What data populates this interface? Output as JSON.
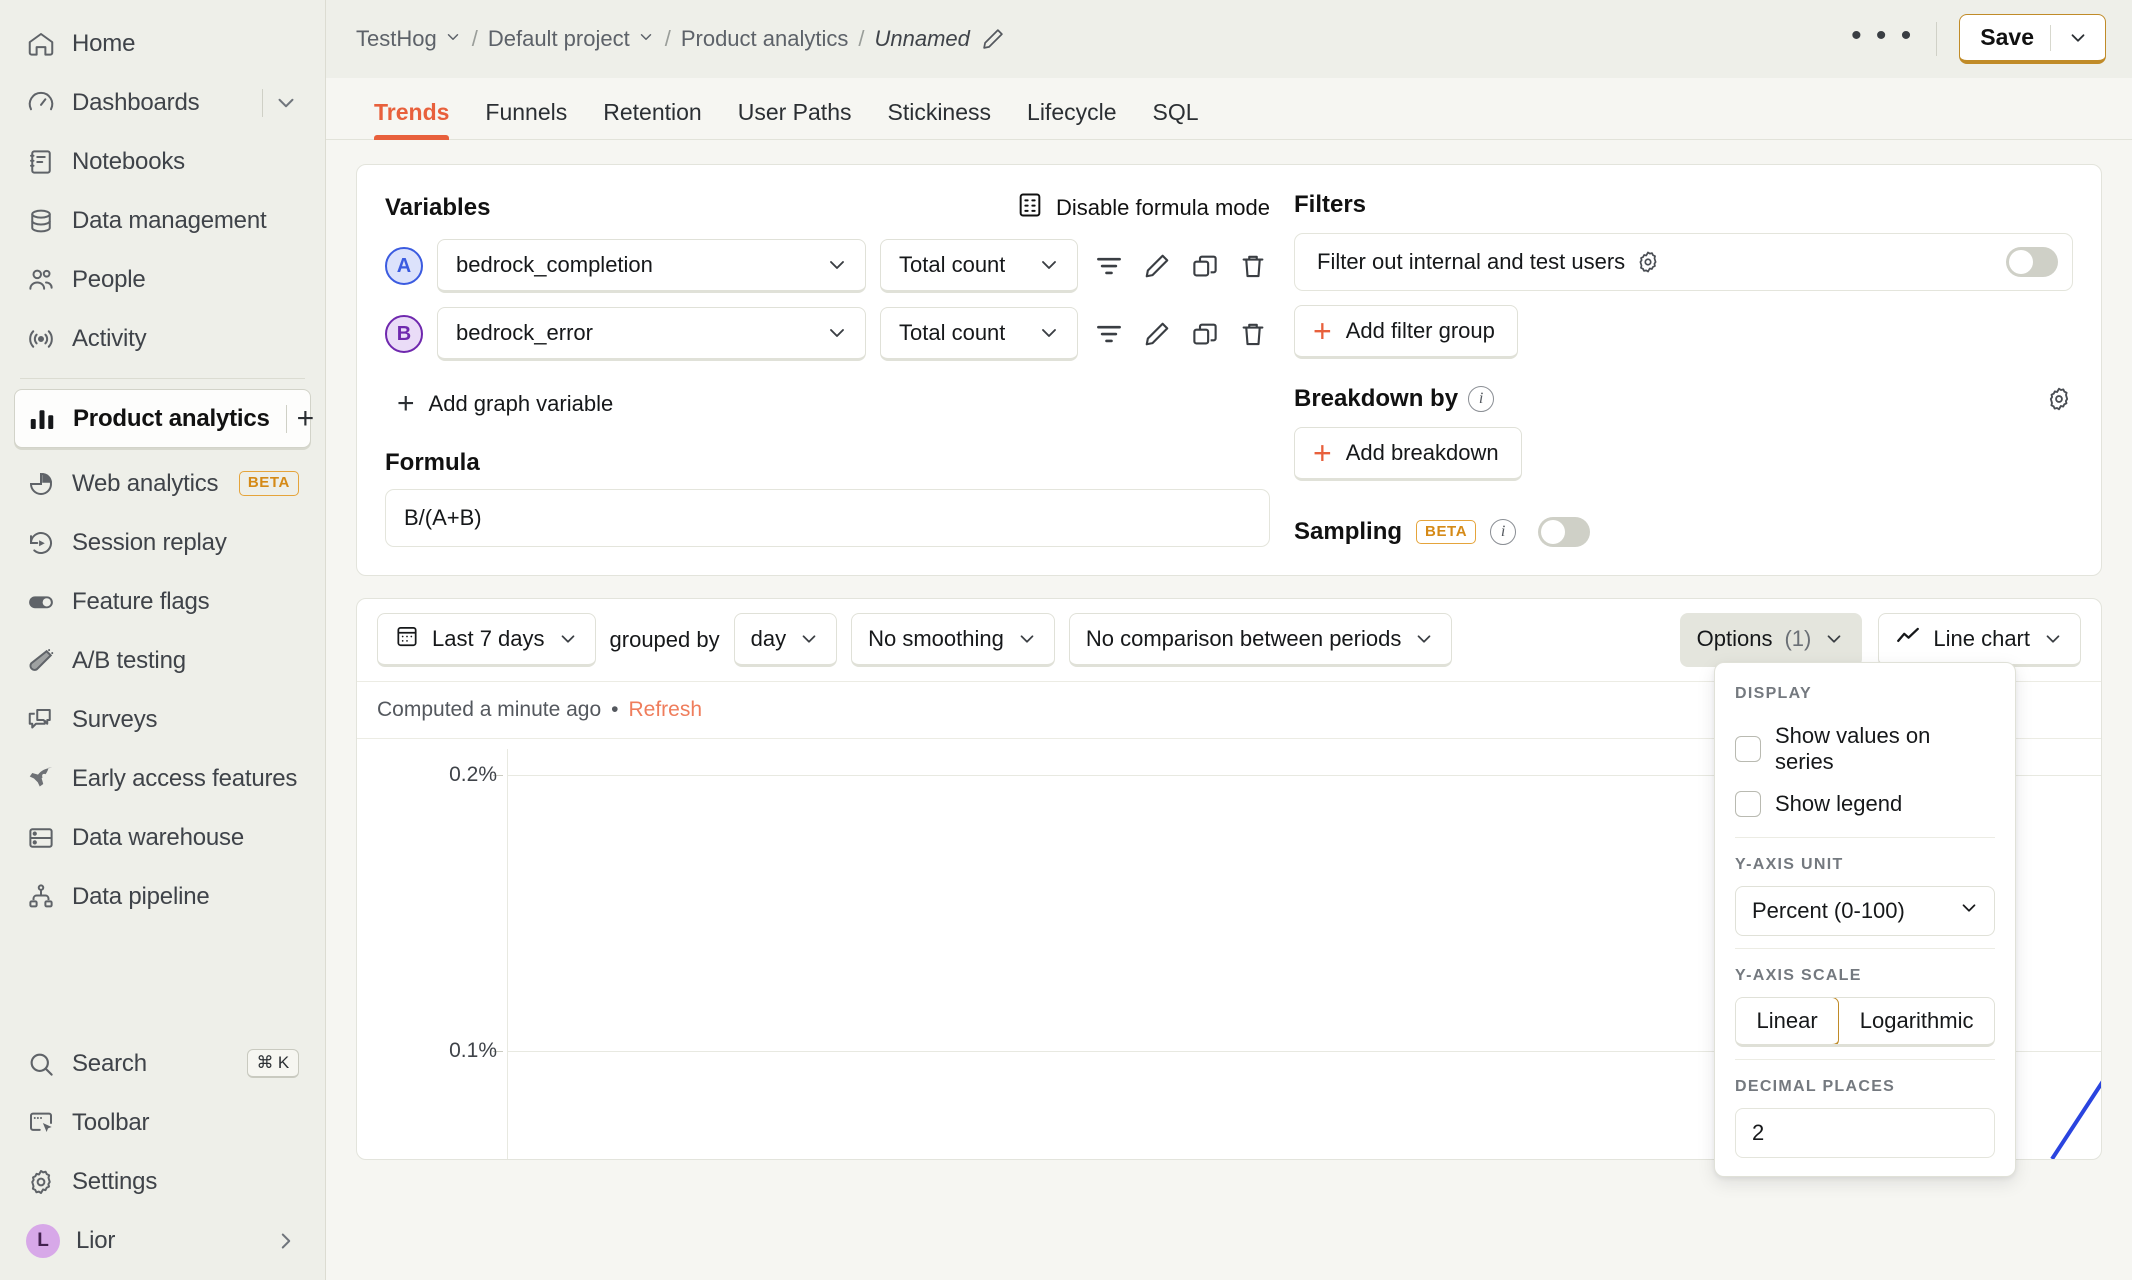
{
  "sidebar": {
    "items": [
      {
        "label": "Home",
        "icon": "home-icon"
      },
      {
        "label": "Dashboards",
        "icon": "gauge-icon",
        "has_expand": true
      },
      {
        "label": "Notebooks",
        "icon": "notebook-icon"
      },
      {
        "label": "Data management",
        "icon": "database-icon"
      },
      {
        "label": "People",
        "icon": "people-icon"
      },
      {
        "label": "Activity",
        "icon": "activity-broadcast-icon"
      }
    ],
    "active_product": {
      "label": "Product analytics",
      "icon": "bar-chart-icon",
      "add_label": "+"
    },
    "products": [
      {
        "label": "Web analytics",
        "icon": "pie-chart-icon",
        "badge": "BETA"
      },
      {
        "label": "Session replay",
        "icon": "replay-icon"
      },
      {
        "label": "Feature flags",
        "icon": "toggle-icon"
      },
      {
        "label": "A/B testing",
        "icon": "flask-icon"
      },
      {
        "label": "Surveys",
        "icon": "chat-icon"
      },
      {
        "label": "Early access features",
        "icon": "rocket-icon"
      },
      {
        "label": "Data warehouse",
        "icon": "warehouse-icon"
      },
      {
        "label": "Data pipeline",
        "icon": "pipeline-icon"
      }
    ],
    "footer": [
      {
        "label": "Search",
        "icon": "search-icon",
        "shortcut": "⌘ K"
      },
      {
        "label": "Toolbar",
        "icon": "toolbar-icon"
      },
      {
        "label": "Settings",
        "icon": "gear-icon"
      }
    ],
    "user": {
      "name": "Lior",
      "initial": "L"
    }
  },
  "topbar": {
    "breadcrumbs": [
      {
        "label": "TestHog",
        "caret": true
      },
      {
        "label": "Default project",
        "caret": true
      },
      {
        "label": "Product analytics",
        "caret": false
      },
      {
        "label": "Unnamed",
        "caret": false,
        "italic": true
      }
    ],
    "separator": "/",
    "more_label": "• • •",
    "save_label": "Save"
  },
  "tabs": [
    {
      "label": "Trends",
      "active": true
    },
    {
      "label": "Funnels",
      "active": false
    },
    {
      "label": "Retention",
      "active": false
    },
    {
      "label": "User Paths",
      "active": false
    },
    {
      "label": "Stickiness",
      "active": false
    },
    {
      "label": "Lifecycle",
      "active": false
    },
    {
      "label": "SQL",
      "active": false
    }
  ],
  "query": {
    "variables_title": "Variables",
    "formula_mode_label": "Disable formula mode",
    "series": [
      {
        "letter": "A",
        "event": "bedrock_completion",
        "math": "Total count"
      },
      {
        "letter": "B",
        "event": "bedrock_error",
        "math": "Total count"
      }
    ],
    "add_variable_label": "Add graph variable",
    "formula_title": "Formula",
    "formula_value": "B/(A+B)",
    "filters_title": "Filters",
    "filter_internal_label": "Filter out internal and test users",
    "add_filter_group_label": "Add filter group",
    "breakdown_title": "Breakdown by",
    "add_breakdown_label": "Add breakdown",
    "sampling_title": "Sampling",
    "sampling_badge": "BETA"
  },
  "insight_toolbar": {
    "date_range": "Last 7 days",
    "grouped_by_label": "grouped by",
    "interval": "day",
    "smoothing": "No smoothing",
    "comparison": "No comparison between periods",
    "options_label": "Options",
    "options_count": "(1)",
    "chart_type": "Line chart"
  },
  "computed": {
    "text": "Computed a minute ago",
    "bullet": "•",
    "refresh_label": "Refresh"
  },
  "options_dropdown": {
    "display_title": "DISPLAY",
    "show_values_label": "Show values on series",
    "show_values_checked": false,
    "show_legend_label": "Show legend",
    "show_legend_checked": false,
    "yaxis_unit_title": "Y-AXIS UNIT",
    "yaxis_unit_value": "Percent (0-100)",
    "yaxis_scale_title": "Y-AXIS SCALE",
    "yaxis_scale_options": [
      "Linear",
      "Logarithmic"
    ],
    "yaxis_scale_selected": "Linear",
    "decimal_places_title": "DECIMAL PLACES",
    "decimal_places_value": "2"
  },
  "colors": {
    "accent_orange": "#e8603c",
    "save_gold": "#c08b28",
    "series_a": "#3b5be0",
    "series_b": "#6f28ae",
    "beta_amber": "#d58a17",
    "line_blue": "#2a44df"
  },
  "chart_data": {
    "type": "line",
    "title": "",
    "xlabel": "",
    "ylabel": "",
    "ytick_labels": [
      "0.2%",
      "0.1%"
    ],
    "ytick_values": [
      0.2,
      0.1
    ],
    "ylim": [
      0.1,
      0.2
    ],
    "grid": true,
    "legend": false,
    "series": [
      {
        "name": "B/(A+B)",
        "color": "#2a44df",
        "x": [
          0,
          1,
          2,
          3,
          4,
          5,
          6
        ],
        "values": [
          null,
          null,
          null,
          null,
          null,
          0.128,
          0.205
        ]
      }
    ]
  }
}
